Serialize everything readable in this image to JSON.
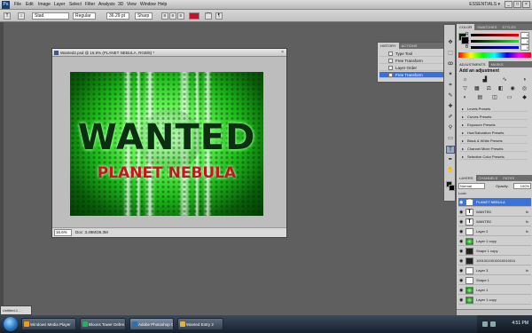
{
  "app": {
    "logo": "Ps",
    "workspace": "ESSENTIALS ▾"
  },
  "menu": [
    "File",
    "Edit",
    "Image",
    "Layer",
    "Select",
    "Filter",
    "Analysis",
    "3D",
    "View",
    "Window",
    "Help"
  ],
  "options": {
    "font_family": "Stad",
    "font_style": "Regular",
    "font_size": "36.29 pt",
    "aa": "Sharp",
    "text_color": "#c8102e"
  },
  "document": {
    "title": "Wanted2.psd @ 16.9% (PLANET NEBULA, RGB/8) *",
    "zoom": "16.6%",
    "info": "Doc: 3.49M/26.3M",
    "headline": "WANTED",
    "subhead": "PLANET NEBULA"
  },
  "history": {
    "tabs": [
      "HISTORY",
      "ACTIONS"
    ],
    "items": [
      {
        "label": "Type Tool",
        "active": false
      },
      {
        "label": "Free Transform",
        "active": false
      },
      {
        "label": "Layer Order",
        "active": false
      },
      {
        "label": "Free Transform",
        "active": true
      }
    ]
  },
  "color": {
    "tabs": [
      "COLOR",
      "SWATCHES",
      "STYLES"
    ],
    "channels": [
      {
        "label": "R",
        "value": "0",
        "gradient": "linear-gradient(90deg,#000,#f00)"
      },
      {
        "label": "G",
        "value": "0",
        "gradient": "linear-gradient(90deg,#000,#0f0)"
      },
      {
        "label": "B",
        "value": "0",
        "gradient": "linear-gradient(90deg,#000,#00f)"
      }
    ]
  },
  "adjustments": {
    "tabs": [
      "ADJUSTMENTS",
      "MASKS"
    ],
    "title": "Add an adjustment",
    "presets": [
      "Levels Presets",
      "Curves Presets",
      "Exposure Presets",
      "Hue/Saturation Presets",
      "Black & White Presets",
      "Channel Mixer Presets",
      "Selective Color Presets"
    ]
  },
  "layers": {
    "tabs": [
      "LAYERS",
      "CHANNELS",
      "PATHS"
    ],
    "blend": "Normal",
    "opacity_label": "Opacity:",
    "opacity": "100%",
    "lock_label": "Lock:",
    "items": [
      {
        "name": "PLANET NEBULA",
        "thumb": "T",
        "kind": "text",
        "fx": "",
        "active": true
      },
      {
        "name": "WANTED",
        "thumb": "T",
        "kind": "text",
        "fx": "fx",
        "active": false
      },
      {
        "name": "WANTED",
        "thumb": "T",
        "kind": "text",
        "fx": "fx",
        "active": false
      },
      {
        "name": "Layer 2",
        "thumb": "",
        "kind": "blank",
        "fx": "fx",
        "active": false
      },
      {
        "name": "Layer 1 copy",
        "thumb": "",
        "kind": "art",
        "fx": "",
        "active": false
      },
      {
        "name": "Shape 1 copy",
        "thumb": "",
        "kind": "dark",
        "fx": "",
        "active": false
      },
      {
        "name": "10010010010010010011",
        "thumb": "",
        "kind": "dark",
        "fx": "",
        "active": false
      },
      {
        "name": "Layer 3",
        "thumb": "",
        "kind": "blank",
        "fx": "fx",
        "active": false
      },
      {
        "name": "Shape 1",
        "thumb": "",
        "kind": "blank",
        "fx": "",
        "active": false
      },
      {
        "name": "Layer 1",
        "thumb": "",
        "kind": "art",
        "fx": "",
        "active": false
      },
      {
        "name": "Layer 1 copy",
        "thumb": "",
        "kind": "art",
        "fx": "",
        "active": false
      }
    ]
  },
  "minimized_doc": "Untitled-1 ...",
  "taskbar": {
    "tasks": [
      {
        "label": "Windows Media Player",
        "color": "#f39c12",
        "active": false
      },
      {
        "label": "Bloons Tower Defen...",
        "color": "#27ae60",
        "active": false
      },
      {
        "label": "Adobe Photoshop C...",
        "color": "#2c6fb3",
        "active": true
      },
      {
        "label": "Wanted Entry 2",
        "color": "#e0b43c",
        "active": false
      }
    ],
    "clock": "4:51 PM"
  }
}
